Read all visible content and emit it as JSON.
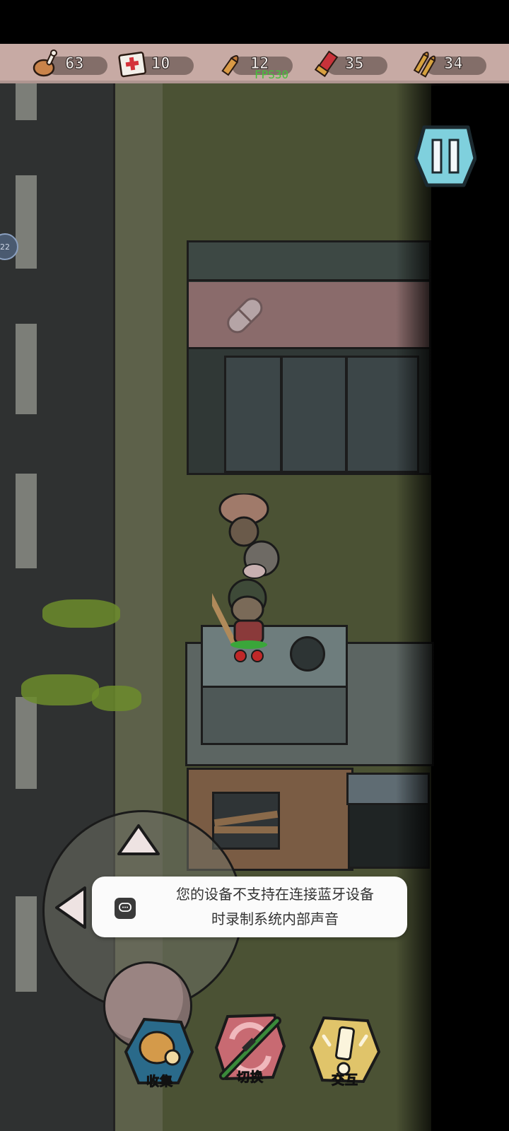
{
  "hud": {
    "resources": [
      {
        "name": "food",
        "icon": "drumstick-icon",
        "value": "63"
      },
      {
        "name": "medkit",
        "icon": "first-aid-kit-icon",
        "value": "10"
      },
      {
        "name": "pistol-ammo",
        "icon": "bullet-icon",
        "value": "12"
      },
      {
        "name": "shotgun-shells",
        "icon": "shotgun-shell-icon",
        "value": "35"
      },
      {
        "name": "rifle-ammo",
        "icon": "rifle-bullets-icon",
        "value": "34"
      }
    ],
    "fps": "FPS30",
    "side_badge": "22"
  },
  "toast": {
    "line1": "您的设备不支持在连接蓝牙设备",
    "line2": "时录制系统内部声音",
    "icon": "chat-bubble-icon"
  },
  "actions": {
    "collect_label": "收集",
    "switch_label": "切换",
    "interact_label": "交互"
  },
  "colors": {
    "resource_bar": "#c7aaa4",
    "grass": "#4b5234",
    "road": "#2f3131",
    "fps_text": "#46c23a",
    "pause_button": "#7fd0dd"
  }
}
